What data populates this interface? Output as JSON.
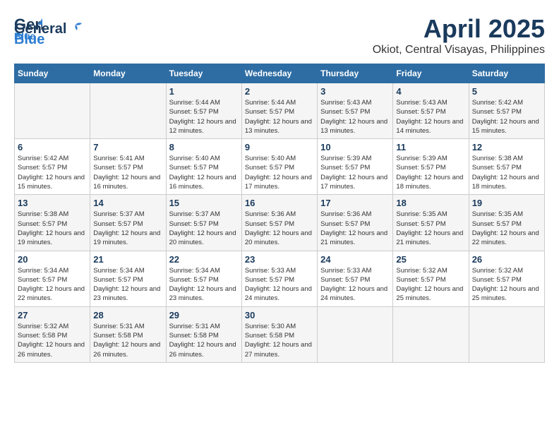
{
  "header": {
    "logo_line1": "General",
    "logo_line2": "Blue",
    "title": "April 2025",
    "subtitle": "Okiot, Central Visayas, Philippines"
  },
  "columns": [
    "Sunday",
    "Monday",
    "Tuesday",
    "Wednesday",
    "Thursday",
    "Friday",
    "Saturday"
  ],
  "weeks": [
    [
      {
        "day": "",
        "empty": true
      },
      {
        "day": "",
        "empty": true
      },
      {
        "day": "1",
        "sunrise": "5:44 AM",
        "sunset": "5:57 PM",
        "daylight": "12 hours and 12 minutes."
      },
      {
        "day": "2",
        "sunrise": "5:44 AM",
        "sunset": "5:57 PM",
        "daylight": "12 hours and 13 minutes."
      },
      {
        "day": "3",
        "sunrise": "5:43 AM",
        "sunset": "5:57 PM",
        "daylight": "12 hours and 13 minutes."
      },
      {
        "day": "4",
        "sunrise": "5:43 AM",
        "sunset": "5:57 PM",
        "daylight": "12 hours and 14 minutes."
      },
      {
        "day": "5",
        "sunrise": "5:42 AM",
        "sunset": "5:57 PM",
        "daylight": "12 hours and 15 minutes."
      }
    ],
    [
      {
        "day": "6",
        "sunrise": "5:42 AM",
        "sunset": "5:57 PM",
        "daylight": "12 hours and 15 minutes."
      },
      {
        "day": "7",
        "sunrise": "5:41 AM",
        "sunset": "5:57 PM",
        "daylight": "12 hours and 16 minutes."
      },
      {
        "day": "8",
        "sunrise": "5:40 AM",
        "sunset": "5:57 PM",
        "daylight": "12 hours and 16 minutes."
      },
      {
        "day": "9",
        "sunrise": "5:40 AM",
        "sunset": "5:57 PM",
        "daylight": "12 hours and 17 minutes."
      },
      {
        "day": "10",
        "sunrise": "5:39 AM",
        "sunset": "5:57 PM",
        "daylight": "12 hours and 17 minutes."
      },
      {
        "day": "11",
        "sunrise": "5:39 AM",
        "sunset": "5:57 PM",
        "daylight": "12 hours and 18 minutes."
      },
      {
        "day": "12",
        "sunrise": "5:38 AM",
        "sunset": "5:57 PM",
        "daylight": "12 hours and 18 minutes."
      }
    ],
    [
      {
        "day": "13",
        "sunrise": "5:38 AM",
        "sunset": "5:57 PM",
        "daylight": "12 hours and 19 minutes."
      },
      {
        "day": "14",
        "sunrise": "5:37 AM",
        "sunset": "5:57 PM",
        "daylight": "12 hours and 19 minutes."
      },
      {
        "day": "15",
        "sunrise": "5:37 AM",
        "sunset": "5:57 PM",
        "daylight": "12 hours and 20 minutes."
      },
      {
        "day": "16",
        "sunrise": "5:36 AM",
        "sunset": "5:57 PM",
        "daylight": "12 hours and 20 minutes."
      },
      {
        "day": "17",
        "sunrise": "5:36 AM",
        "sunset": "5:57 PM",
        "daylight": "12 hours and 21 minutes."
      },
      {
        "day": "18",
        "sunrise": "5:35 AM",
        "sunset": "5:57 PM",
        "daylight": "12 hours and 21 minutes."
      },
      {
        "day": "19",
        "sunrise": "5:35 AM",
        "sunset": "5:57 PM",
        "daylight": "12 hours and 22 minutes."
      }
    ],
    [
      {
        "day": "20",
        "sunrise": "5:34 AM",
        "sunset": "5:57 PM",
        "daylight": "12 hours and 22 minutes."
      },
      {
        "day": "21",
        "sunrise": "5:34 AM",
        "sunset": "5:57 PM",
        "daylight": "12 hours and 23 minutes."
      },
      {
        "day": "22",
        "sunrise": "5:34 AM",
        "sunset": "5:57 PM",
        "daylight": "12 hours and 23 minutes."
      },
      {
        "day": "23",
        "sunrise": "5:33 AM",
        "sunset": "5:57 PM",
        "daylight": "12 hours and 24 minutes."
      },
      {
        "day": "24",
        "sunrise": "5:33 AM",
        "sunset": "5:57 PM",
        "daylight": "12 hours and 24 minutes."
      },
      {
        "day": "25",
        "sunrise": "5:32 AM",
        "sunset": "5:57 PM",
        "daylight": "12 hours and 25 minutes."
      },
      {
        "day": "26",
        "sunrise": "5:32 AM",
        "sunset": "5:57 PM",
        "daylight": "12 hours and 25 minutes."
      }
    ],
    [
      {
        "day": "27",
        "sunrise": "5:32 AM",
        "sunset": "5:58 PM",
        "daylight": "12 hours and 26 minutes."
      },
      {
        "day": "28",
        "sunrise": "5:31 AM",
        "sunset": "5:58 PM",
        "daylight": "12 hours and 26 minutes."
      },
      {
        "day": "29",
        "sunrise": "5:31 AM",
        "sunset": "5:58 PM",
        "daylight": "12 hours and 26 minutes."
      },
      {
        "day": "30",
        "sunrise": "5:30 AM",
        "sunset": "5:58 PM",
        "daylight": "12 hours and 27 minutes."
      },
      {
        "day": "",
        "empty": true
      },
      {
        "day": "",
        "empty": true
      },
      {
        "day": "",
        "empty": true
      }
    ]
  ],
  "daylight_label": "Daylight:",
  "sunrise_label": "Sunrise:",
  "sunset_label": "Sunset:"
}
